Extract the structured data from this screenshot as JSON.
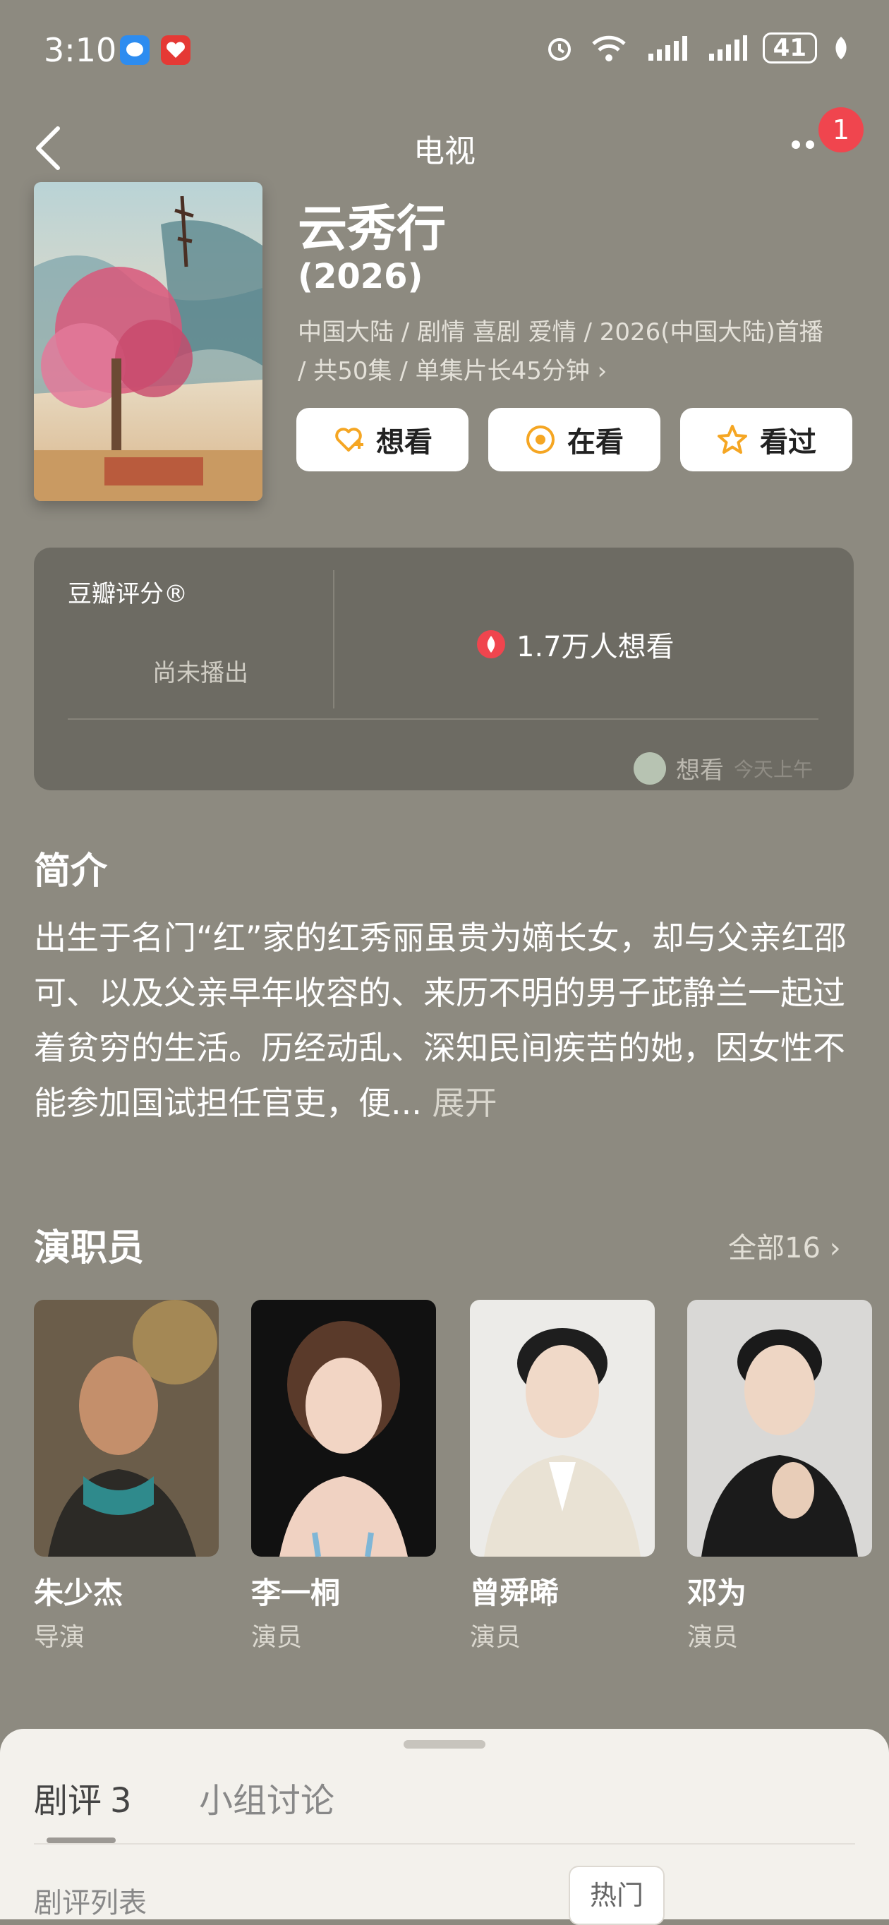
{
  "status_bar": {
    "time": "3:10",
    "battery": "41"
  },
  "nav": {
    "title": "电视",
    "notification_count": "1"
  },
  "show": {
    "title": "云秀行",
    "year": "(2026)",
    "meta": "中国大陆 / 剧情 喜剧 爱情 / 2026(中国大陆)首播 / 共50集 / 单集片长45分钟 ›"
  },
  "actions": [
    {
      "label": "想看",
      "icon": "heart-plus-icon",
      "color": "#f5a623"
    },
    {
      "label": "在看",
      "icon": "target-circle-icon",
      "color": "#f5a623"
    },
    {
      "label": "看过",
      "icon": "star-icon",
      "color": "#f5a623"
    }
  ],
  "rating": {
    "label": "豆瓣评分®",
    "status": "尚未播出",
    "want_count": "1.7万人想看",
    "recent_action": "想看",
    "recent_time": "今天上午"
  },
  "synopsis": {
    "heading": "简介",
    "text": "出生于名门“红”家的红秀丽虽贵为嫡长女，却与父亲红邵可、以及父亲早年收容的、来历不明的男子茈静兰一起过着贫穷的生活。历经动乱、深知民间疾苦的她，因女性不能参加国试担任官吏，便...",
    "expand": "展开"
  },
  "cast": {
    "heading": "演职员",
    "all_link": "全部16 ›",
    "members": [
      {
        "name": "朱少杰",
        "role": "导演"
      },
      {
        "name": "李一桐",
        "role": "演员"
      },
      {
        "name": "曾舜晞",
        "role": "演员"
      },
      {
        "name": "邓为",
        "role": "演员"
      }
    ]
  },
  "bottom_sheet": {
    "tab_reviews": "剧评",
    "tab_reviews_count": "3",
    "tab_group": "小组讨论",
    "list_label": "剧评列表",
    "sort_hot": "热门"
  },
  "colors": {
    "accent": "#f5a623",
    "badge_red": "#f0454e",
    "background": "#8d8a80"
  }
}
